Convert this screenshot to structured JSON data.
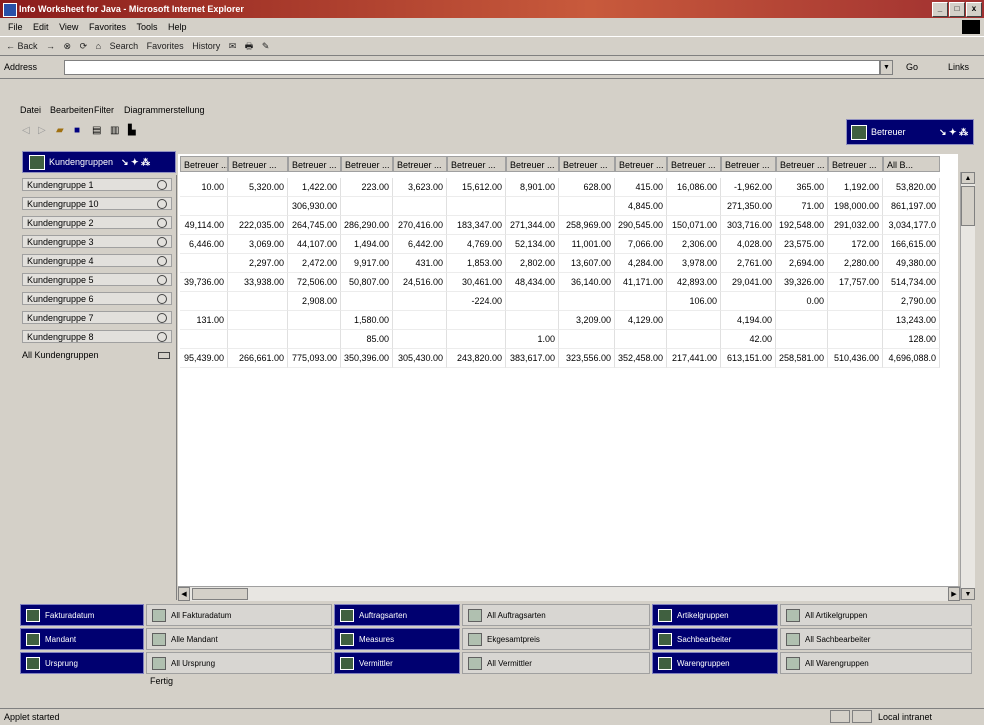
{
  "window": {
    "title": "Info Worksheet for Java - Microsoft Internet Explorer"
  },
  "browser_menu": [
    "File",
    "Edit",
    "View",
    "Favorites",
    "Tools",
    "Help"
  ],
  "browser_toolbar": [
    "← Back",
    "→",
    "⊗",
    "⟳",
    "⌂",
    "Search",
    "Favorites",
    "History",
    "✉",
    "🖶",
    "✎"
  ],
  "address": {
    "label": "Address",
    "value": "",
    "go": "Go",
    "links": "Links"
  },
  "app_menu": [
    "Datei",
    "Bearbeiten",
    "Filter",
    "Diagrammerstellung"
  ],
  "betreuer_button": {
    "label": "Betreuer",
    "syms": "↘ ✦ ⁂"
  },
  "kundengruppen_button": {
    "label": "Kundengruppen",
    "syms": "↘ ✦ ⁂"
  },
  "column_headers": [
    "Betreuer ...",
    "Betreuer ...",
    "Betreuer ...",
    "Betreuer ...",
    "Betreuer ...",
    "Betreuer ...",
    "Betreuer ...",
    "Betreuer ...",
    "Betreuer ...",
    "Betreuer ...",
    "Betreuer ...",
    "Betreuer ...",
    "Betreuer ...",
    "All B..."
  ],
  "row_labels": [
    "Kundengruppe 1",
    "Kundengruppe 10",
    "Kundengruppe 2",
    "Kundengruppe 3",
    "Kundengruppe 4",
    "Kundengruppe 5",
    "Kundengruppe 6",
    "Kundengruppe 7",
    "Kundengruppe 8"
  ],
  "all_row_label": "All Kundengruppen",
  "rows": [
    [
      "10.00",
      "5,320.00",
      "1,422.00",
      "223.00",
      "3,623.00",
      "15,612.00",
      "8,901.00",
      "628.00",
      "415.00",
      "16,086.00",
      "-1,962.00",
      "365.00",
      "1,192.00",
      "53,820.00"
    ],
    [
      "",
      "",
      "306,930.00",
      "",
      "",
      "",
      "",
      "",
      "4,845.00",
      "",
      "271,350.00",
      "71.00",
      "198,000.00",
      "861,197.00"
    ],
    [
      "49,114.00",
      "222,035.00",
      "264,745.00",
      "286,290.00",
      "270,416.00",
      "183,347.00",
      "271,344.00",
      "258,969.00",
      "290,545.00",
      "150,071.00",
      "303,716.00",
      "192,548.00",
      "291,032.00",
      "3,034,177.0"
    ],
    [
      "6,446.00",
      "3,069.00",
      "44,107.00",
      "1,494.00",
      "6,442.00",
      "4,769.00",
      "52,134.00",
      "11,001.00",
      "7,066.00",
      "2,306.00",
      "4,028.00",
      "23,575.00",
      "172.00",
      "166,615.00"
    ],
    [
      "",
      "2,297.00",
      "2,472.00",
      "9,917.00",
      "431.00",
      "1,853.00",
      "2,802.00",
      "13,607.00",
      "4,284.00",
      "3,978.00",
      "2,761.00",
      "2,694.00",
      "2,280.00",
      "49,380.00"
    ],
    [
      "39,736.00",
      "33,938.00",
      "72,506.00",
      "50,807.00",
      "24,516.00",
      "30,461.00",
      "48,434.00",
      "36,140.00",
      "41,171.00",
      "42,893.00",
      "29,041.00",
      "39,326.00",
      "17,757.00",
      "514,734.00"
    ],
    [
      "",
      "",
      "2,908.00",
      "",
      "",
      "-224.00",
      "",
      "",
      "",
      "106.00",
      "",
      "0.00",
      "",
      "2,790.00"
    ],
    [
      "131.00",
      "",
      "",
      "1,580.00",
      "",
      "",
      "",
      "3,209.00",
      "4,129.00",
      "",
      "4,194.00",
      "",
      "",
      "13,243.00"
    ],
    [
      "",
      "",
      "",
      "85.00",
      "",
      "",
      "1.00",
      "",
      "",
      "",
      "42.00",
      "",
      "",
      "128.00"
    ],
    [
      "95,439.00",
      "266,661.00",
      "775,093.00",
      "350,396.00",
      "305,430.00",
      "243,820.00",
      "383,617.00",
      "323,556.00",
      "352,458.00",
      "217,441.00",
      "613,151.00",
      "258,581.00",
      "510,436.00",
      "4,696,088.0"
    ]
  ],
  "dimensions": [
    [
      {
        "label": "Fakturadatum",
        "style": "blue"
      },
      {
        "label": "All Fakturadatum",
        "style": "gray"
      },
      {
        "label": "Auftragsarten",
        "style": "blue"
      },
      {
        "label": "All Auftragsarten",
        "style": "gray"
      },
      {
        "label": "Artikelgruppen",
        "style": "blue"
      },
      {
        "label": "All Artikelgruppen",
        "style": "gray"
      }
    ],
    [
      {
        "label": "Mandant",
        "style": "blue"
      },
      {
        "label": "Alle Mandant",
        "style": "gray"
      },
      {
        "label": "Measures",
        "style": "blue"
      },
      {
        "label": "Ekgesamtpreis",
        "style": "gray"
      },
      {
        "label": "Sachbearbeiter",
        "style": "blue"
      },
      {
        "label": "All Sachbearbeiter",
        "style": "gray"
      }
    ],
    [
      {
        "label": "Ursprung",
        "style": "blue"
      },
      {
        "label": "All Ursprung",
        "style": "gray"
      },
      {
        "label": "Vermittler",
        "style": "blue"
      },
      {
        "label": "All Vermittler",
        "style": "gray"
      },
      {
        "label": "Warengruppen",
        "style": "blue"
      },
      {
        "label": "All Warengruppen",
        "style": "gray"
      }
    ]
  ],
  "applet_status": "Fertig",
  "statusbar": {
    "left": "Applet started",
    "right": "Local intranet"
  }
}
